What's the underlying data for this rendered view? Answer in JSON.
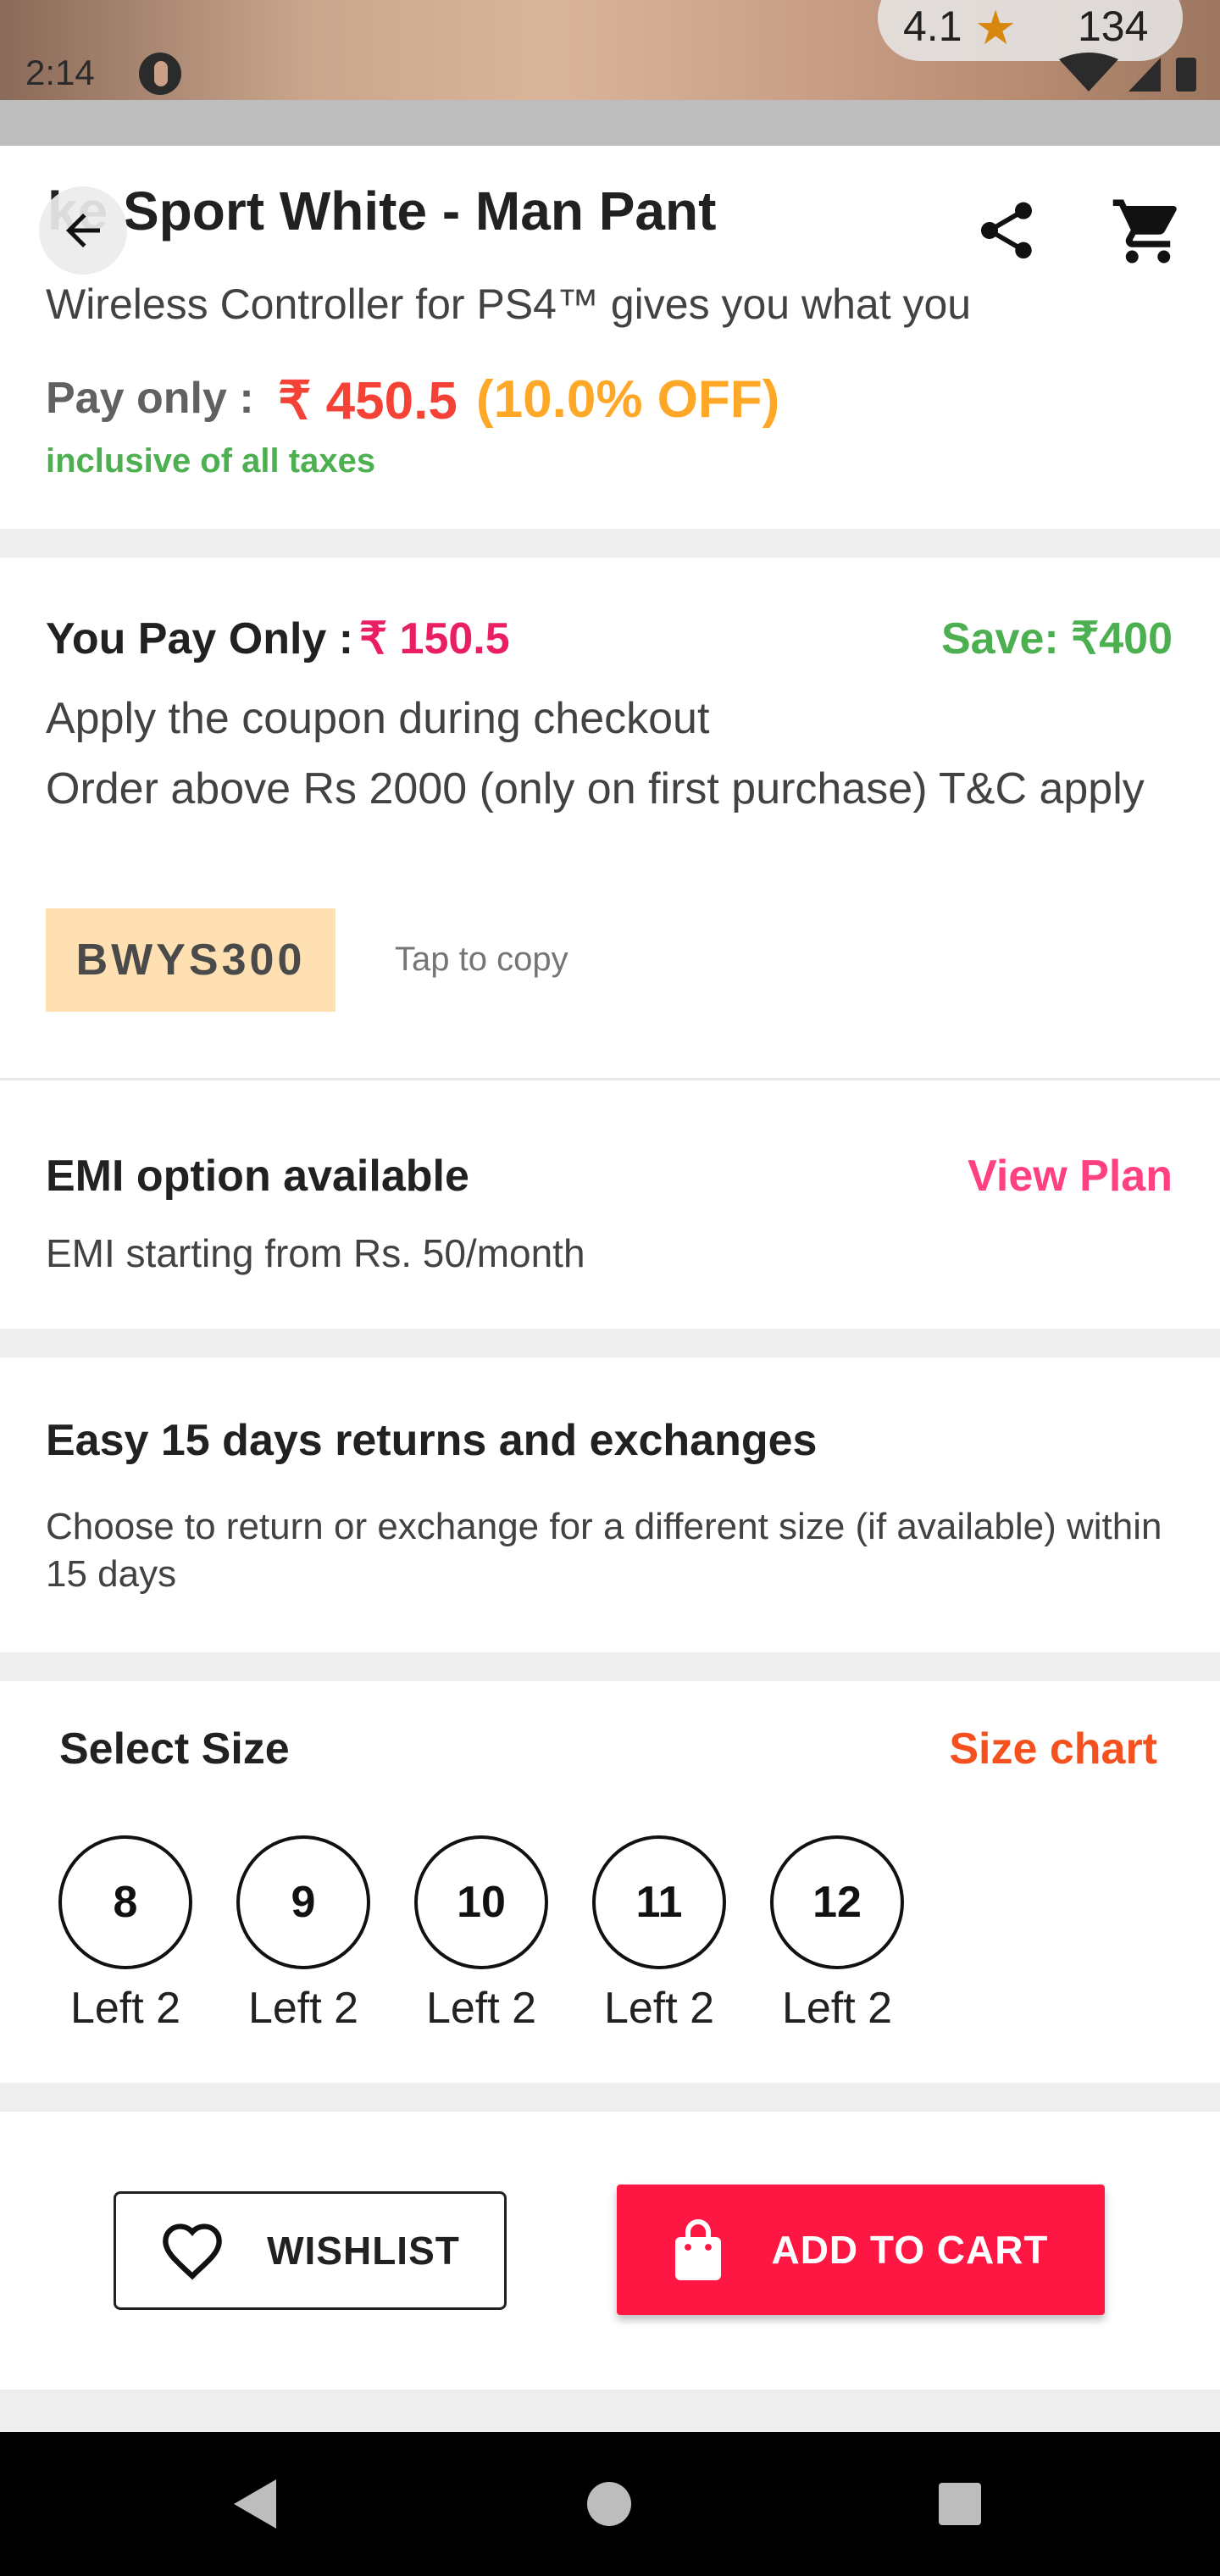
{
  "status_bar": {
    "time": "2:14",
    "icons": [
      "wifi-icon",
      "signal-icon",
      "battery-icon"
    ]
  },
  "rating": {
    "value": "4.1",
    "count": "134",
    "star_color": "#d8870e"
  },
  "product": {
    "title": "Nike Sport White - Man Pant",
    "title_visible": "ke Sport White - Man Pant",
    "description": "Wireless Controller for PS4™ gives you what you",
    "pay_only_label": "Pay only :",
    "price": "₹ 450.5",
    "discount": "(10.0% OFF)",
    "taxes_note": "inclusive of all taxes"
  },
  "coupon": {
    "you_pay_label": "You Pay Only :",
    "you_pay_price": "₹ 150.5",
    "save_text": "Save: ₹400",
    "line1": "Apply the coupon during checkout",
    "line2": "Order above Rs 2000 (only on first purchase) T&C apply",
    "code": "BWYS300",
    "tap_to_copy": "Tap to copy"
  },
  "emi": {
    "title": "EMI option available",
    "link": "View Plan",
    "subtitle": "EMI starting from Rs. 50/month"
  },
  "returns": {
    "title": "Easy 15 days returns and exchanges",
    "description": "Choose to return or exchange for a different size (if available) within 15 days"
  },
  "sizes": {
    "title": "Select Size",
    "chart_link": "Size chart",
    "options": [
      {
        "size": "8",
        "stock": "Left 2"
      },
      {
        "size": "9",
        "stock": "Left 2"
      },
      {
        "size": "10",
        "stock": "Left 2"
      },
      {
        "size": "11",
        "stock": "Left 2"
      },
      {
        "size": "12",
        "stock": "Left 2"
      }
    ]
  },
  "actions": {
    "wishlist_label": "WISHLIST",
    "add_to_cart_label": "ADD TO CART",
    "accent": "#ff1744"
  },
  "nav": {
    "icons": [
      "back-triangle-icon",
      "home-circle-icon",
      "recents-square-icon"
    ]
  }
}
